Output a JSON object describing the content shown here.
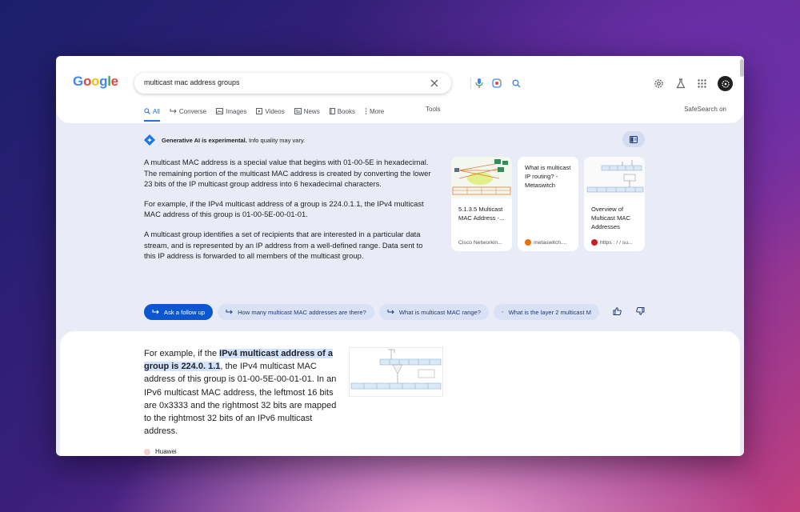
{
  "logo": {
    "letters": [
      "G",
      "o",
      "o",
      "g",
      "l",
      "e"
    ],
    "colors": [
      "#4285F4",
      "#EA4335",
      "#FBBC05",
      "#4285F4",
      "#34A853",
      "#EA4335"
    ]
  },
  "search": {
    "query": "multicast mac address groups"
  },
  "tabs": [
    {
      "label": "All",
      "icon": "search-icon"
    },
    {
      "label": "Converse",
      "icon": "reply-arrow-icon"
    },
    {
      "label": "Images",
      "icon": "image-icon"
    },
    {
      "label": "Videos",
      "icon": "play-icon"
    },
    {
      "label": "News",
      "icon": "news-icon"
    },
    {
      "label": "Books",
      "icon": "book-icon"
    },
    {
      "label": "More",
      "icon": "more-vert-icon"
    }
  ],
  "tools_label": "Tools",
  "safesearch_label": "SafeSearch on",
  "ai": {
    "badge_bold": "Generative AI is experimental.",
    "badge_rest": " Info quality may vary.",
    "paragraphs": [
      "A multicast MAC address is a special value that begins with 01-00-5E in hexadecimal. The remaining portion of the multicast MAC address is created by converting the lower 23 bits of the IP multicast group address into 6 hexadecimal characters.",
      "For example, if the IPv4 multicast address of a group is 224.0.1.1, the IPv4 multicast MAC address of this group is 01-00-5E-00-01-01.",
      "A multicast group identifies a set of recipients that are interested in a particular data stream, and is represented by an IP address from a well-defined range. Data sent to this IP address is forwarded to all members of the multicast group."
    ],
    "sources": [
      {
        "title": "5.1.3.5 Multicast MAC Address -...",
        "site": "Cisco Networkin...",
        "fav_color": "#ffffff"
      },
      {
        "title": "What is multicast IP routing? - Metaswitch",
        "site": "metaswitch....",
        "fav_color": "#e8710a"
      },
      {
        "title": "Overview of Multicast MAC Addresses",
        "site": "https : / / su...",
        "fav_color": "#c5221f"
      }
    ]
  },
  "chips": {
    "follow_up": "Ask a follow up",
    "suggestions": [
      "How many multicast MAC addresses are there?",
      "What is multicast MAC range?",
      "What is the layer 2 multicast M"
    ]
  },
  "result": {
    "before": "For example, if the ",
    "highlight": "IPv4 multicast address of a group is 224.0. 1.1",
    "after": ", the IPv4 multicast MAC address of this group is 01-00-5E-00-01-01. In an IPv6 multicast MAC address, the leftmost 16 bits are 0x3333 and the rightmost 32 bits are mapped to the rightmost 32 bits of an IPv6 multicast address.",
    "source": "Huawei"
  }
}
